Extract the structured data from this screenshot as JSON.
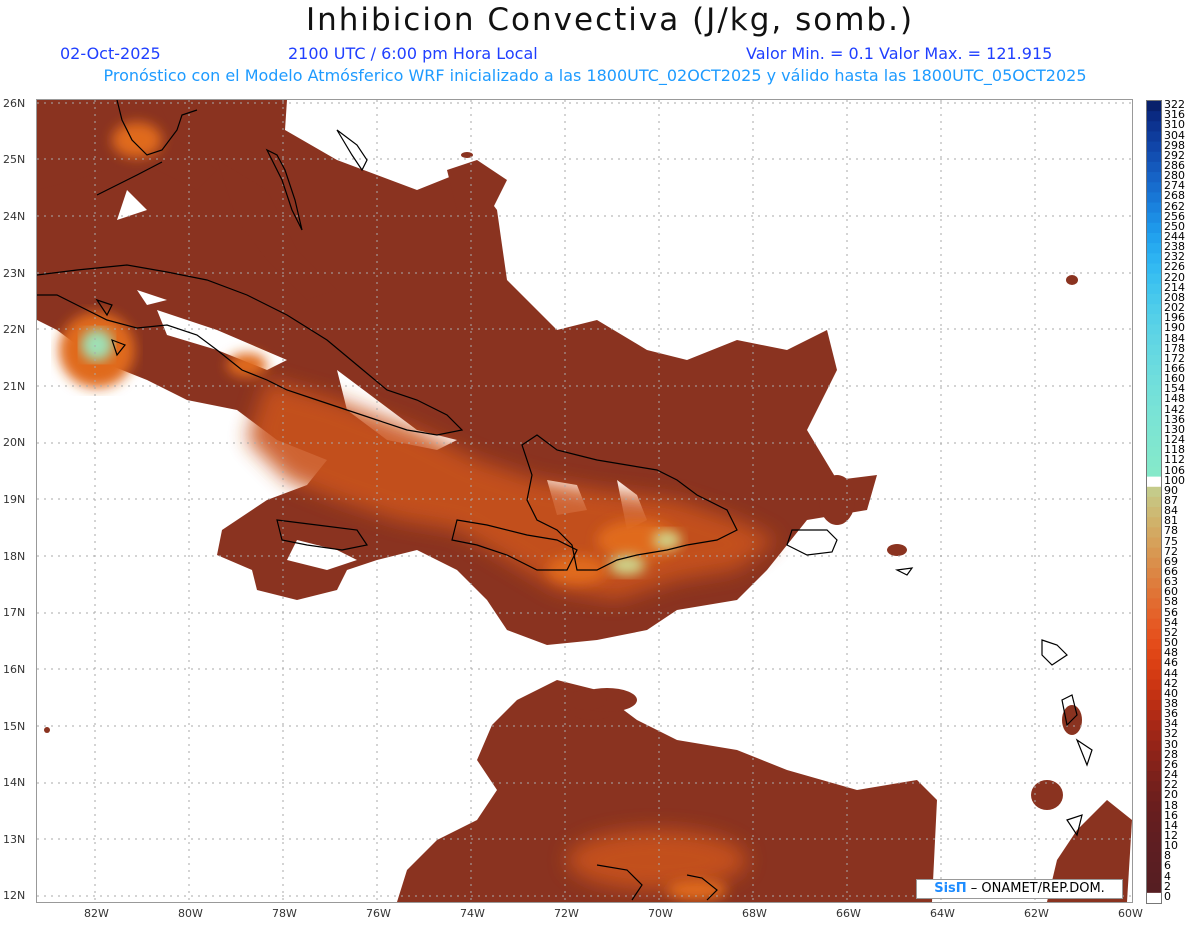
{
  "title": "Inhibicion Convectiva (J/kg, somb.)",
  "date": "02-Oct-2025",
  "time": "2100 UTC / 6:00 pm Hora Local",
  "minmax": "Valor Min. = 0.1  Valor Max. = 121.915",
  "info": "Pronóstico con el Modelo Atmósferico WRF inicializado a las 1800UTC_02OCT2025 y válido hasta las  1800UTC_05OCT2025",
  "credit": {
    "logo": "SisΠ",
    "text": " – ONAMET/REP.DOM."
  },
  "map": {
    "lat_labels": [
      "26N",
      "25N",
      "24N",
      "23N",
      "22N",
      "21N",
      "20N",
      "19N",
      "18N",
      "17N",
      "16N",
      "15N",
      "14N",
      "13N",
      "12N"
    ],
    "lon_labels": [
      "82W",
      "80W",
      "78W",
      "76W",
      "74W",
      "72W",
      "70W",
      "68W",
      "66W",
      "64W",
      "62W",
      "60W"
    ],
    "shading_colors": {
      "dark": "#8a2e1c",
      "mid": "#b8471f",
      "warm": "#e2731c",
      "light": "#c9d98a",
      "cyan": "#7fe0d0"
    }
  },
  "colorbar": {
    "labels": [
      "322",
      "316",
      "310",
      "304",
      "298",
      "292",
      "286",
      "280",
      "274",
      "268",
      "262",
      "256",
      "250",
      "244",
      "238",
      "232",
      "226",
      "220",
      "214",
      "208",
      "202",
      "196",
      "190",
      "184",
      "178",
      "172",
      "166",
      "160",
      "154",
      "148",
      "142",
      "136",
      "130",
      "124",
      "118",
      "112",
      "106",
      "100",
      "90",
      "87",
      "84",
      "81",
      "78",
      "75",
      "72",
      "69",
      "66",
      "63",
      "60",
      "58",
      "56",
      "54",
      "52",
      "50",
      "48",
      "46",
      "44",
      "42",
      "40",
      "38",
      "36",
      "34",
      "32",
      "30",
      "28",
      "26",
      "24",
      "22",
      "20",
      "18",
      "16",
      "14",
      "12",
      "10",
      "8",
      "6",
      "4",
      "2",
      "0"
    ],
    "colors": [
      "#08206b",
      "#0a2a82",
      "#0c3390",
      "#0e3c9c",
      "#1045a8",
      "#124fb2",
      "#1459bc",
      "#1663c6",
      "#176dce",
      "#1877d6",
      "#1a82de",
      "#1c8de4",
      "#1e98ea",
      "#22a2ee",
      "#27abf0",
      "#2db3f2",
      "#33baf2",
      "#3ac0f0",
      "#41c5ee",
      "#48c9ec",
      "#4fcdea",
      "#55d0e8",
      "#5bd3e6",
      "#60d5e4",
      "#64d8e2",
      "#68dae0",
      "#6cdcde",
      "#70dedc",
      "#73e0da",
      "#76e1d8",
      "#79e3d6",
      "#7be4d4",
      "#7de5d2",
      "#7fe6d0",
      "#81e7ce",
      "#83e8cc",
      "#85e9ca",
      "#ffffff",
      "#c5cb8a",
      "#c9c27e",
      "#cdba74",
      "#d0b26a",
      "#d3a962",
      "#d6a15a",
      "#d89852",
      "#da8f4b",
      "#dc8644",
      "#de7d3d",
      "#e07436",
      "#e26b30",
      "#e4632a",
      "#e55a24",
      "#e5531f",
      "#e44c1a",
      "#e04616",
      "#db4014",
      "#d43b13",
      "#cc3613",
      "#c33213",
      "#ba2e14",
      "#b12b15",
      "#a72816",
      "#9e2617",
      "#952418",
      "#8c2319",
      "#84221a",
      "#7c211b",
      "#75201c",
      "#6f1f1d",
      "#6a1e1e",
      "#661e1f",
      "#631e20",
      "#601e21",
      "#5e1e22",
      "#5c1e22",
      "#5a1e22",
      "#581e22",
      "#561e22",
      "#ffffff"
    ]
  }
}
